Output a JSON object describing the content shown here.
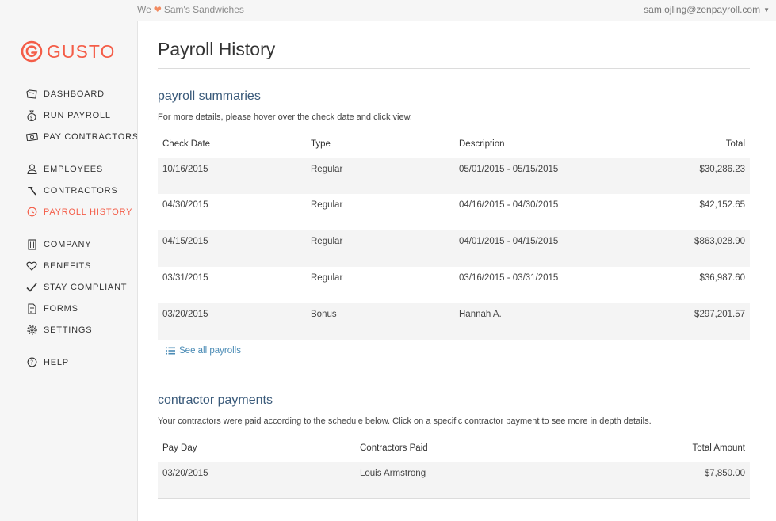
{
  "topbar": {
    "we_label": "We",
    "company": "Sam's Sandwiches",
    "account": "sam.ojling@zenpayroll.com"
  },
  "brand": {
    "name": "GUSTO",
    "color": "#f45d48"
  },
  "sidebar": {
    "groups": [
      [
        {
          "label": "DASHBOARD",
          "icon": "dashboard-icon"
        },
        {
          "label": "RUN PAYROLL",
          "icon": "money-bag-icon"
        },
        {
          "label": "PAY CONTRACTORS",
          "icon": "cash-icon"
        }
      ],
      [
        {
          "label": "EMPLOYEES",
          "icon": "person-icon"
        },
        {
          "label": "CONTRACTORS",
          "icon": "hammer-icon"
        },
        {
          "label": "PAYROLL HISTORY",
          "icon": "clock-icon",
          "active": true
        }
      ],
      [
        {
          "label": "COMPANY",
          "icon": "building-icon"
        },
        {
          "label": "BENEFITS",
          "icon": "heart-icon"
        },
        {
          "label": "STAY COMPLIANT",
          "icon": "checkmark-icon"
        },
        {
          "label": "FORMS",
          "icon": "document-icon"
        },
        {
          "label": "SETTINGS",
          "icon": "gear-icon"
        }
      ],
      [
        {
          "label": "HELP",
          "icon": "help-icon"
        }
      ]
    ]
  },
  "main": {
    "title": "Payroll History",
    "payroll": {
      "title": "payroll summaries",
      "description": "For more details, please hover over the check date and click view.",
      "columns": [
        "Check Date",
        "Type",
        "Description",
        "Total"
      ],
      "rows": [
        [
          "10/16/2015",
          "Regular",
          "05/01/2015 - 05/15/2015",
          "$30,286.23"
        ],
        [
          "04/30/2015",
          "Regular",
          "04/16/2015 - 04/30/2015",
          "$42,152.65"
        ],
        [
          "04/15/2015",
          "Regular",
          "04/01/2015 - 04/15/2015",
          "$863,028.90"
        ],
        [
          "03/31/2015",
          "Regular",
          "03/16/2015 - 03/31/2015",
          "$36,987.60"
        ],
        [
          "03/20/2015",
          "Bonus",
          "Hannah A.",
          "$297,201.57"
        ]
      ],
      "see_all": "See all payrolls"
    },
    "contractors": {
      "title": "contractor payments",
      "description": "Your contractors were paid according to the schedule below. Click on a specific contractor payment to see more in depth details.",
      "columns": [
        "Pay Day",
        "Contractors Paid",
        "Total Amount"
      ],
      "rows": [
        [
          "03/20/2015",
          "Louis Armstrong",
          "$7,850.00"
        ]
      ]
    }
  },
  "colors": {
    "accent": "#f45d48",
    "link": "#4a8bb5",
    "section_title": "#3a5a7a"
  }
}
